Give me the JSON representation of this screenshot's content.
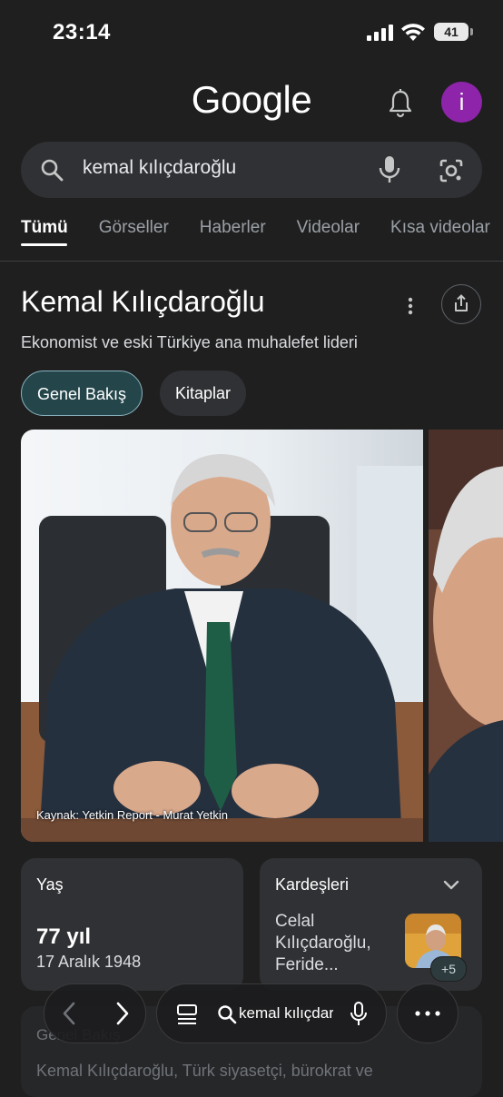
{
  "status_bar": {
    "time": "23:14",
    "battery": "41"
  },
  "header": {
    "logo": "Google",
    "avatar_letter": "i"
  },
  "search": {
    "query": "kemal kılıçdaroğlu"
  },
  "tabs": [
    {
      "label": "Tümü",
      "active": true
    },
    {
      "label": "Görseller"
    },
    {
      "label": "Haberler"
    },
    {
      "label": "Videolar"
    },
    {
      "label": "Kısa videolar"
    }
  ],
  "knowledge_panel": {
    "title": "Kemal Kılıçdaroğlu",
    "subtitle": "Ekonomist ve eski Türkiye ana muhalefet lideri",
    "chips": [
      "Genel Bakış",
      "Kitaplar"
    ],
    "image_source": "Kaynak: Yetkin Report - Murat Yetkin",
    "age_card": {
      "label": "Yaş",
      "value": "77 yıl",
      "date": "17 Aralık 1948"
    },
    "siblings_card": {
      "label": "Kardeşleri",
      "text": "Celal Kılıçdaroğlu, Feride...",
      "more": "+5"
    },
    "faded_card": {
      "heading": "Genel Bakış",
      "text": "Kemal Kılıçdaroğlu, Türk siyasetçi, bürokrat ve"
    }
  },
  "toolbar": {
    "address": "kemal kılıçdaroğlu"
  },
  "colors": {
    "avatar": "#8e24aa",
    "active_chip": "#24464b",
    "background": "#1f1f1f"
  }
}
